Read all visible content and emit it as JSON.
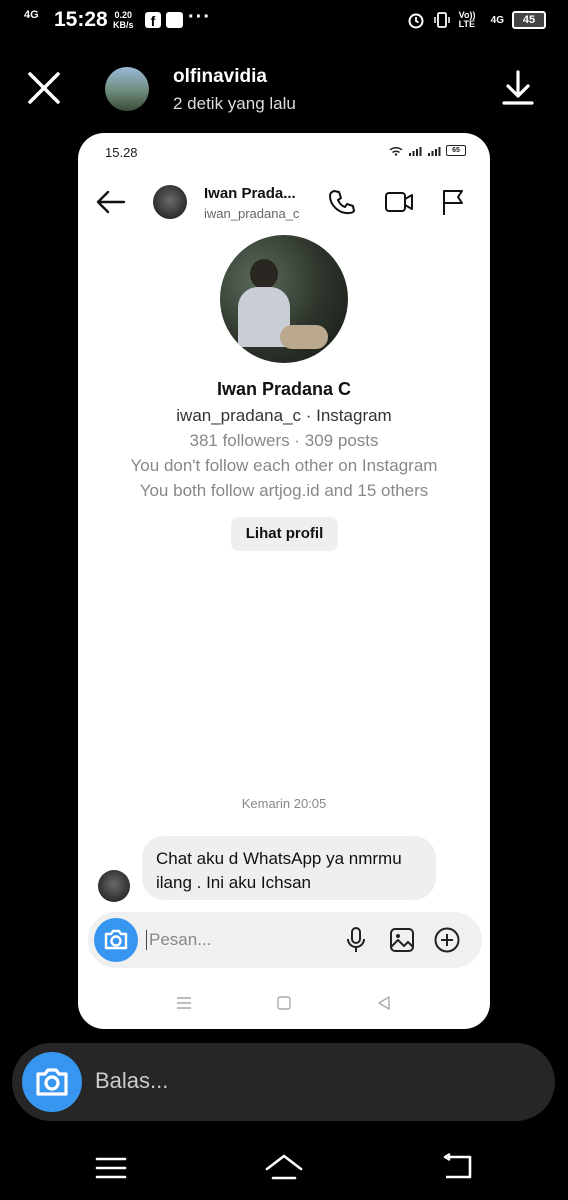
{
  "status_bar": {
    "network": "4G",
    "time": "15:28",
    "speed_value": "0.20",
    "speed_unit": "KB/s",
    "more": "···",
    "volte": "Vo)) LTE",
    "network_right": "4G",
    "battery": "45"
  },
  "story": {
    "username": "olfinavidia",
    "time_ago": "2 detik yang lalu"
  },
  "inner_status": {
    "time": "15.28",
    "battery": "65"
  },
  "chat_header": {
    "name": "Iwan Prada...",
    "username": "iwan_pradana_c"
  },
  "profile": {
    "name": "Iwan Pradana C",
    "handle_line": "iwan_pradana_c · Instagram",
    "stats_line": "381 followers · 309 posts",
    "follow_status": "You don't follow each other on Instagram",
    "mutual": "You both follow artjog.id and 15 others",
    "view_profile_label": "Lihat profil"
  },
  "conversation": {
    "timestamp": "Kemarin 20:05",
    "message_text": "Chat aku d WhatsApp ya nmrmu ilang . Ini aku Ichsan"
  },
  "composer": {
    "placeholder": "Pesan..."
  },
  "reply_bar": {
    "placeholder": "Balas..."
  },
  "colors": {
    "accent_blue": "#3797f0",
    "background": "#000000",
    "bubble": "#efefef"
  }
}
